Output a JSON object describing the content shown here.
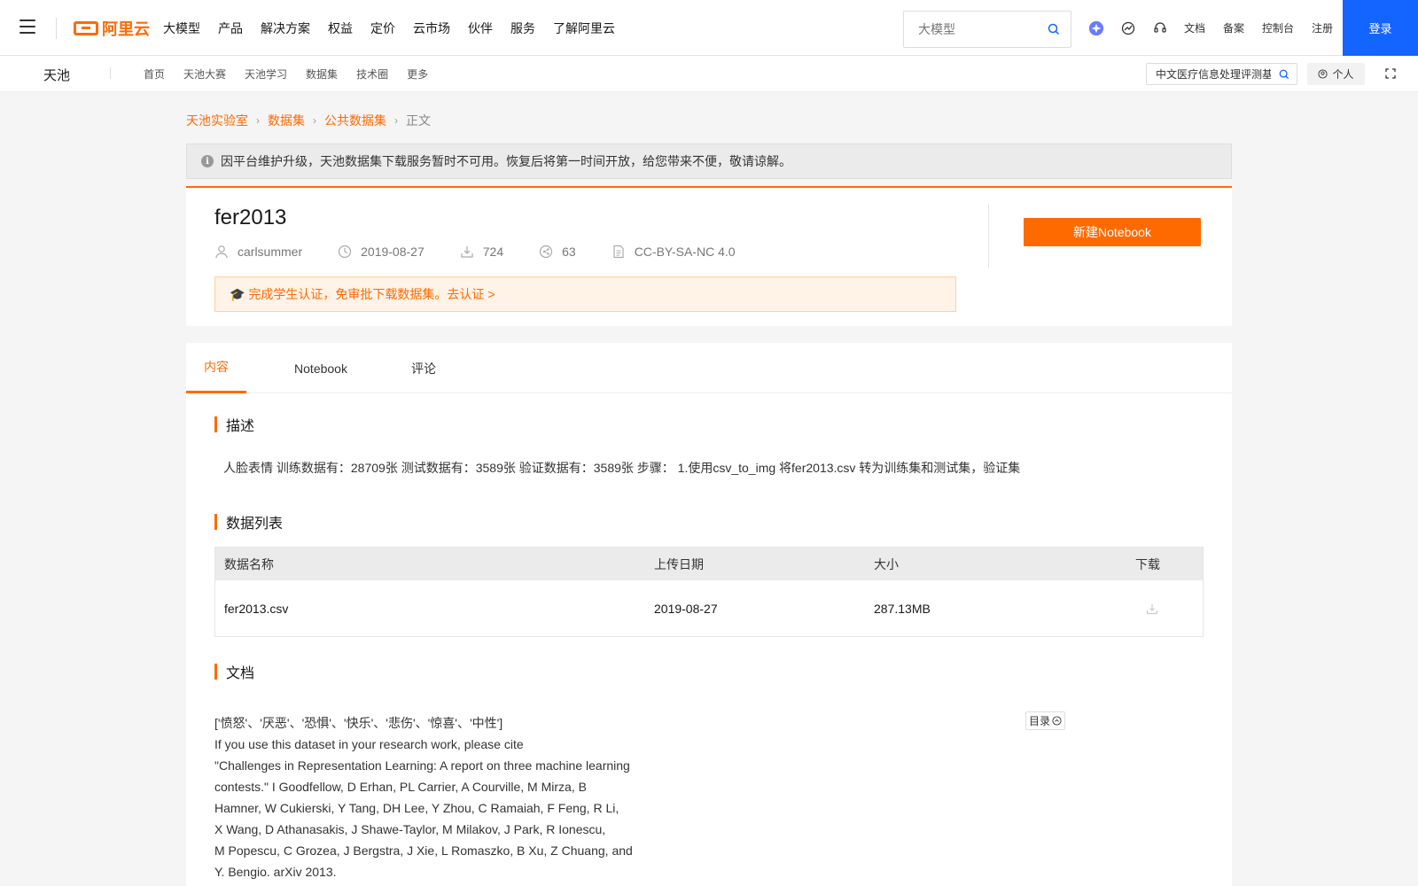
{
  "topbar": {
    "logo": "阿里云",
    "nav": [
      "大模型",
      "产品",
      "解决方案",
      "权益",
      "定价",
      "云市场",
      "伙伴",
      "服务",
      "了解阿里云"
    ],
    "search_placeholder": "大模型",
    "links": [
      "文档",
      "备案",
      "控制台",
      "注册"
    ],
    "login": "登录",
    "icons": [
      "star-badge-icon",
      "activity-icon",
      "headset-icon"
    ]
  },
  "subbar": {
    "brand": "天池",
    "nav": [
      "首页",
      "天池大赛",
      "天池学习",
      "数据集",
      "技术圈",
      "更多"
    ],
    "search_value": "中文医疗信息处理评测基",
    "personal": "个人"
  },
  "breadcrumb": [
    "天池实验室",
    "数据集",
    "公共数据集",
    "正文"
  ],
  "notice": "因平台维护升级，天池数据集下载服务暂时不可用。恢复后将第一时间开放，给您带来不便，敬请谅解。",
  "dataset": {
    "title": "fer2013",
    "author": "carlsummer",
    "date": "2019-08-27",
    "downloads": "724",
    "shares": "63",
    "license": "CC-BY-SA-NC 4.0",
    "student_notice": "完成学生认证，免审批下载数据集。去认证 >",
    "new_notebook": "新建Notebook"
  },
  "tabs": [
    "内容",
    "Notebook",
    "评论"
  ],
  "sections": {
    "desc_title": "描述",
    "desc_text": "人脸表情 训练数据有：28709张 测试数据有：3589张 验证数据有：3589张 步骤： 1.使用csv_to_img 将fer2013.csv 转为训练集和测试集，验证集",
    "list_title": "数据列表",
    "doc_title": "文档"
  },
  "table": {
    "headers": [
      "数据名称",
      "上传日期",
      "大小",
      "下载"
    ],
    "rows": [
      {
        "name": "fer2013.csv",
        "date": "2019-08-27",
        "size": "287.13MB"
      }
    ]
  },
  "doc": {
    "lines": [
      "['愤怒'、'厌恶'、'恐惧'、'快乐'、'悲伤'、'惊喜'、'中性']",
      "If you use this dataset in your research work, please cite",
      "\"Challenges in Representation Learning: A report on three machine learning",
      "contests.\" I Goodfellow, D Erhan, PL Carrier, A Courville, M Mirza, B",
      "Hamner, W Cukierski, Y Tang, DH Lee, Y Zhou, C Ramaiah, F Feng, R Li,",
      "X Wang, D Athanasakis, J Shawe-Taylor, M Milakov, J Park, R Ionescu,",
      "M Popescu, C Grozea, J Bergstra, J Xie, L Romaszko, B Xu, Z Chuang, and",
      "Y. Bengio. arXiv 2013."
    ],
    "toc": "目录"
  },
  "colors": {
    "accent": "#ff6a00",
    "login_blue": "#1464ff"
  }
}
